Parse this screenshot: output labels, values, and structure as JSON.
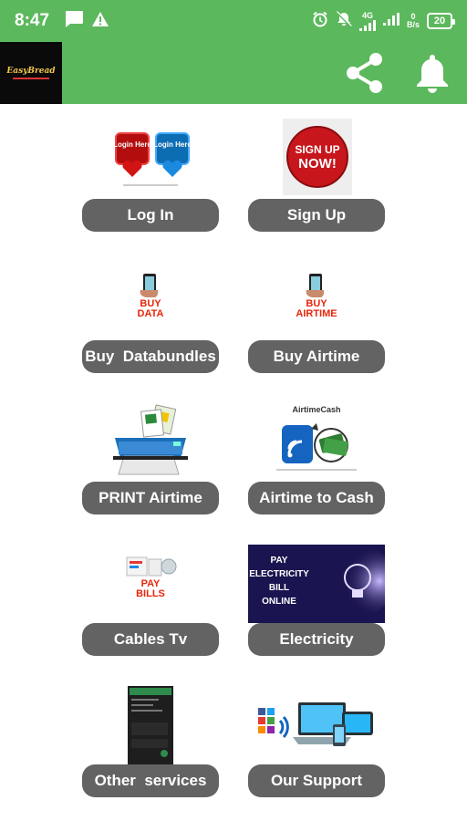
{
  "status_bar": {
    "time": "8:47",
    "network_type": "4G",
    "data_rate_value": "0",
    "data_rate_unit": "B/s",
    "battery": "20"
  },
  "app_bar": {
    "logo_text": "EasyBread",
    "share_icon": "share-icon",
    "notification_icon": "bell-icon",
    "accent_color": "#5cb85c"
  },
  "menu": [
    {
      "id": "login",
      "label": "Log In",
      "image_text": [
        "Login Here",
        "Login Here"
      ]
    },
    {
      "id": "signup",
      "label": "Sign Up",
      "image_text": [
        "SIGN UP",
        "NOW!"
      ]
    },
    {
      "id": "buy-data",
      "label": "Buy  Databundles",
      "image_text": [
        "BUY",
        "DATA"
      ]
    },
    {
      "id": "buy-airtime",
      "label": "Buy Airtime",
      "image_text": [
        "BUY",
        "AIRTIME"
      ]
    },
    {
      "id": "print-airtime",
      "label": "PRINT Airtime"
    },
    {
      "id": "airtime-to-cash",
      "label": "Airtime to Cash",
      "image_text": [
        "AirtimeCash"
      ]
    },
    {
      "id": "cables-tv",
      "label": "Cables Tv",
      "image_text": [
        "PAY",
        "BILLS"
      ]
    },
    {
      "id": "electricity",
      "label": "Electricity",
      "image_text": [
        "PAY",
        "ELECTRICITY",
        "BILL",
        "ONLINE"
      ]
    },
    {
      "id": "other-services",
      "label": "Other  services"
    },
    {
      "id": "our-support",
      "label": "Our Support"
    }
  ],
  "colors": {
    "button_bg": "#636363",
    "button_text": "#ffffff"
  }
}
